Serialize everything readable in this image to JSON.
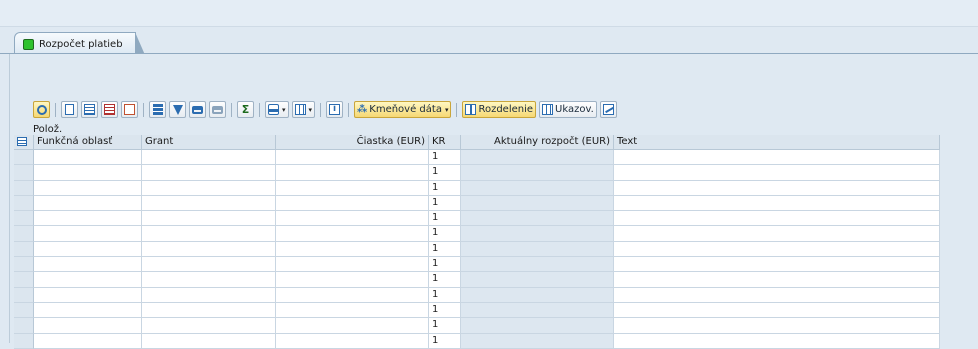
{
  "tab": {
    "label": "Rozpočet platieb",
    "status_color": "#2ec22e"
  },
  "toolbar": {
    "master_data_label": "Kmeňové dáta",
    "split_label": "Rozdelenie",
    "display_label": "Ukazov."
  },
  "section_label": "Polož.",
  "table": {
    "columns": [
      "Funkčná oblasť",
      "Grant",
      "Čiastka (EUR)",
      "KR",
      "Aktuálny rozpočt (EUR)",
      "Text"
    ],
    "rows": [
      {
        "kr": "1"
      },
      {
        "kr": "1"
      },
      {
        "kr": "1"
      },
      {
        "kr": "1"
      },
      {
        "kr": "1"
      },
      {
        "kr": "1"
      },
      {
        "kr": "1"
      },
      {
        "kr": "1"
      },
      {
        "kr": "1"
      },
      {
        "kr": "1"
      },
      {
        "kr": "1"
      },
      {
        "kr": "1"
      },
      {
        "kr": "1"
      }
    ]
  }
}
